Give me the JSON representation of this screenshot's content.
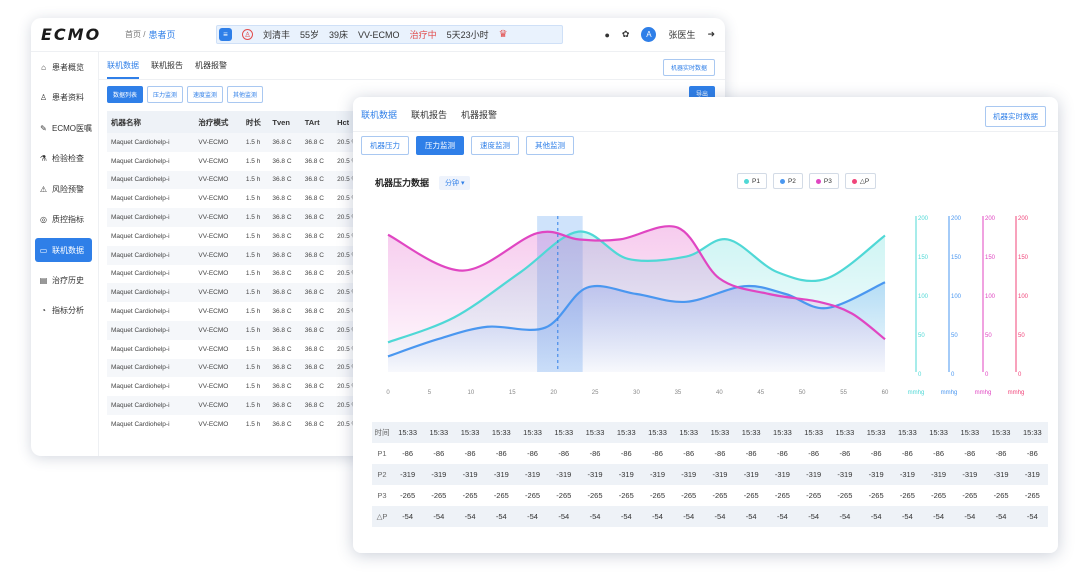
{
  "app": {
    "logo": "ECMO",
    "crumb_home": "首页 /",
    "crumb_current": "患者页"
  },
  "patient": {
    "name": "刘清丰",
    "age": "55岁",
    "bed": "39床",
    "mode": "VV-ECMO",
    "state": "治疗中",
    "duration": "5天23小时"
  },
  "user": {
    "name": "张医生",
    "avatar": "A"
  },
  "sidebar": [
    {
      "icon": "⌂",
      "label": "患者概览"
    },
    {
      "icon": "♙",
      "label": "患者资料"
    },
    {
      "icon": "✎",
      "label": "ECMO医嘱"
    },
    {
      "icon": "⚗",
      "label": "检验检查"
    },
    {
      "icon": "⚠",
      "label": "风险预警"
    },
    {
      "icon": "◎",
      "label": "质控指标"
    },
    {
      "icon": "▭",
      "label": "联机数据",
      "active": true
    },
    {
      "icon": "▤",
      "label": "治疗历史"
    },
    {
      "icon": "◔",
      "label": "指标分析"
    }
  ],
  "back": {
    "tabs": [
      "联机数据",
      "联机报告",
      "机器报警"
    ],
    "realtime": "机器实时数据",
    "sub": [
      "数据列表",
      "压力监测",
      "速度监测",
      "其他监测"
    ],
    "export": "导出",
    "headers": [
      "机器名称",
      "治疗模式",
      "时长",
      "Tven",
      "TArt",
      "Hct"
    ],
    "rows": [
      [
        "Maquet Cardiohelp-i",
        "VV-ECMO",
        "1.5 h",
        "36.8 C",
        "36.8 C",
        "20.5 %"
      ],
      [
        "Maquet Cardiohelp-i",
        "VV-ECMO",
        "1.5 h",
        "36.8 C",
        "36.8 C",
        "20.5 %"
      ],
      [
        "Maquet Cardiohelp-i",
        "VV-ECMO",
        "1.5 h",
        "36.8 C",
        "36.8 C",
        "20.5 %"
      ],
      [
        "Maquet Cardiohelp-i",
        "VV-ECMO",
        "1.5 h",
        "36.8 C",
        "36.8 C",
        "20.5 %"
      ],
      [
        "Maquet Cardiohelp-i",
        "VV-ECMO",
        "1.5 h",
        "36.8 C",
        "36.8 C",
        "20.5 %"
      ],
      [
        "Maquet Cardiohelp-i",
        "VV-ECMO",
        "1.5 h",
        "36.8 C",
        "36.8 C",
        "20.5 %"
      ],
      [
        "Maquet Cardiohelp-i",
        "VV-ECMO",
        "1.5 h",
        "36.8 C",
        "36.8 C",
        "20.5 %"
      ],
      [
        "Maquet Cardiohelp-i",
        "VV-ECMO",
        "1.5 h",
        "36.8 C",
        "36.8 C",
        "20.5 %"
      ],
      [
        "Maquet Cardiohelp-i",
        "VV-ECMO",
        "1.5 h",
        "36.8 C",
        "36.8 C",
        "20.5 %"
      ],
      [
        "Maquet Cardiohelp-i",
        "VV-ECMO",
        "1.5 h",
        "36.8 C",
        "36.8 C",
        "20.5 %"
      ],
      [
        "Maquet Cardiohelp-i",
        "VV-ECMO",
        "1.5 h",
        "36.8 C",
        "36.8 C",
        "20.5 %"
      ],
      [
        "Maquet Cardiohelp-i",
        "VV-ECMO",
        "1.5 h",
        "36.8 C",
        "36.8 C",
        "20.5 %"
      ],
      [
        "Maquet Cardiohelp-i",
        "VV-ECMO",
        "1.5 h",
        "36.8 C",
        "36.8 C",
        "20.5 %"
      ],
      [
        "Maquet Cardiohelp-i",
        "VV-ECMO",
        "1.5 h",
        "36.8 C",
        "36.8 C",
        "20.5 %"
      ],
      [
        "Maquet Cardiohelp-i",
        "VV-ECMO",
        "1.5 h",
        "36.8 C",
        "36.8 C",
        "20.5 %"
      ],
      [
        "Maquet Cardiohelp-i",
        "VV-ECMO",
        "1.5 h",
        "36.8 C",
        "36.8 C",
        "20.5 %"
      ]
    ]
  },
  "front": {
    "tabs": [
      "联机数据",
      "联机报告",
      "机器报警"
    ],
    "realtime": "机器实时数据",
    "sub": [
      "机器压力",
      "压力监测",
      "速度监测",
      "其他监测"
    ],
    "chart_title": "机器压力数据",
    "unit_select": "分钟",
    "legend": [
      "P1",
      "P2",
      "P3",
      "△P"
    ]
  },
  "chart_data": {
    "type": "line",
    "x_ticks": [
      0,
      5,
      10,
      15,
      20,
      25,
      30,
      35,
      40,
      45,
      50,
      55,
      60
    ],
    "xlim": [
      0,
      60
    ],
    "ylim": [
      0,
      200
    ],
    "y_ticks": [
      "200",
      "150",
      "100",
      "50",
      "0"
    ],
    "y_unit": "mmhg",
    "highlight_x": [
      18,
      23.5
    ],
    "cursor_x": 20.5,
    "series": [
      {
        "name": "P1",
        "color": "#4fd8d6",
        "x": [
          0,
          8,
          16,
          23,
          29,
          36,
          41,
          47,
          53,
          60
        ],
        "values": [
          38,
          70,
          128,
          180,
          145,
          148,
          170,
          128,
          120,
          175
        ]
      },
      {
        "name": "P2",
        "color": "#4a97f0",
        "x": [
          0,
          6,
          12,
          19,
          24,
          30,
          36,
          43,
          48,
          53,
          60
        ],
        "values": [
          20,
          42,
          58,
          57,
          108,
          100,
          90,
          110,
          100,
          82,
          115
        ]
      },
      {
        "name": "P3",
        "color": "#e046c2",
        "x": [
          0,
          9,
          18,
          23,
          28,
          35,
          40,
          46,
          52,
          56,
          60
        ],
        "values": [
          176,
          130,
          178,
          170,
          170,
          185,
          120,
          100,
          90,
          75,
          42
        ]
      }
    ]
  },
  "table": {
    "labels": [
      "时间",
      "P1",
      "P2",
      "P3",
      "△P"
    ],
    "time": "15:33",
    "values": {
      "P1": "-86",
      "P2": "-319",
      "P3": "-265",
      "dP": "-54"
    },
    "count": 21
  },
  "colors": {
    "accent": "#2f7fe8",
    "danger": "#e24c4c",
    "p4": "#f0457a"
  }
}
